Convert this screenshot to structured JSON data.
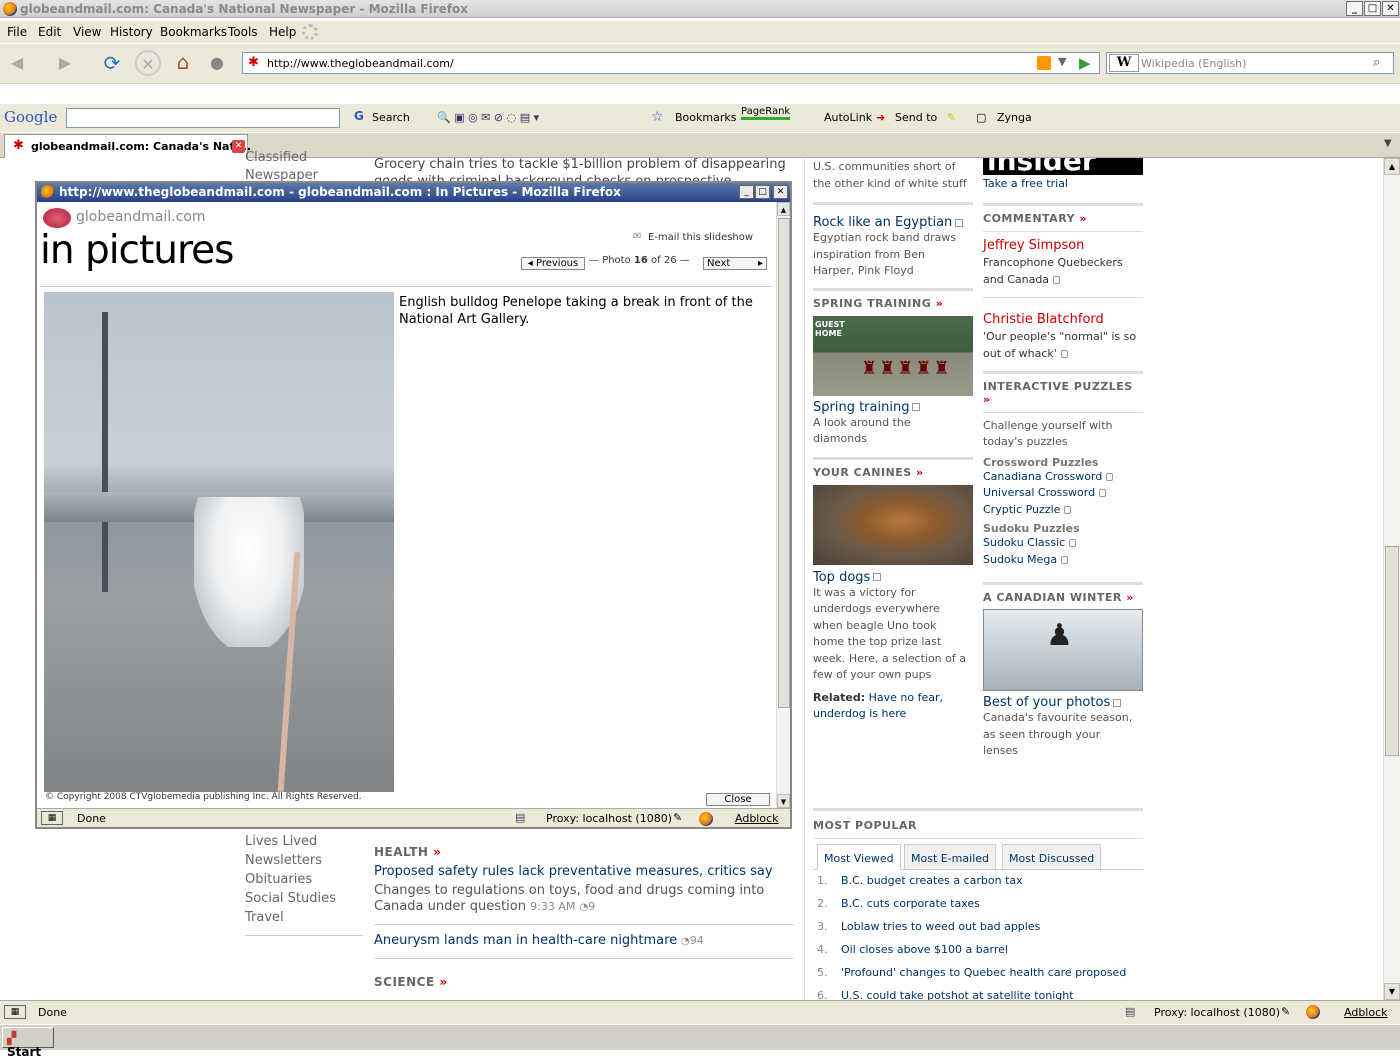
{
  "window": {
    "title": "globeandmail.com: Canada's National Newspaper - Mozilla Firefox",
    "minimize": "_",
    "maximize": "□",
    "close": "✕"
  },
  "menu": [
    "File",
    "Edit",
    "View",
    "History",
    "Bookmarks",
    "Tools",
    "Help"
  ],
  "address": {
    "url": "http://www.theglobeandmail.com/",
    "search_placeholder": "Wikipedia (English)"
  },
  "google_toolbar": {
    "logo": "Google",
    "search": "Search",
    "bookmarks": "Bookmarks",
    "pagerank": "PageRank",
    "autolink": "AutoLink",
    "sendto": "Send to",
    "zynga": "Zynga"
  },
  "tab": {
    "label": "globeandmail.com: Canada's Nati..."
  },
  "page": {
    "left_nav_top": [
      "Classified",
      "Newspaper Ads"
    ],
    "left_nav_bottom": [
      "Lives Lived",
      "Newsletters",
      "Obituaries",
      "Social Studies",
      "Travel"
    ],
    "center_top_text": [
      "Grocery chain tries to tackle $1-billion problem of disappearing",
      "goods with criminal background checks on prospective employees"
    ],
    "health": {
      "heading": "HEALTH",
      "story1_title": "Proposed safety rules lack preventative measures, critics say",
      "story1_text1": "Changes to regulations on toys, food and drugs coming into",
      "story1_text2": "Canada under question",
      "story1_time": "9:33 AM",
      "story1_comments": "9",
      "story2_title": "Aneurysm lands man in health-care nightmare",
      "story2_comments": "94"
    },
    "science": {
      "heading": "SCIENCE"
    },
    "col3": {
      "top_text1": "U.S. communities short of",
      "top_text2": "the other kind of white stuff",
      "egypt_title": "Rock like an Egyptian",
      "egypt_text": [
        "Egyptian rock band draws",
        "inspiration from Ben",
        "Harper, Pink Floyd"
      ],
      "spring_heading": "SPRING TRAINING",
      "spring_title": "Spring training",
      "spring_text": [
        "A look around the",
        "diamonds"
      ],
      "spring_scoreboard": "GUEST HOME",
      "canines_heading": "YOUR CANINES",
      "topdogs_title": "Top dogs",
      "topdogs_text": [
        "It was a victory for",
        "underdogs everywhere",
        "when beagle Uno took",
        "home the top prize last",
        "week. Here, a selection of a",
        "few of your own pups"
      ],
      "related_label": "Related:",
      "related_link1": "Have no fear,",
      "related_link2": "underdog is here"
    },
    "col4": {
      "insider_text": "insider",
      "trial": "Take a free trial",
      "commentary_heading": "COMMENTARY",
      "simpson_name": "Jeffrey Simpson",
      "simpson_text1": "Francophone Quebeckers",
      "simpson_text2": "and Canada",
      "blatch_name": "Christie Blatchford",
      "blatch_text1": "'Our people's \"normal\" is so",
      "blatch_text2": "out of whack'",
      "puzzles_heading": "INTERACTIVE PUZZLES",
      "puzzles_text1": "Challenge yourself with",
      "puzzles_text2": "today's puzzles",
      "crossword_heading": "Crossword Puzzles",
      "crossword_links": [
        "Canadiana Crossword",
        "Universal Crossword",
        "Cryptic Puzzle"
      ],
      "sudoku_heading": "Sudoku Puzzles",
      "sudoku_links": [
        "Sudoku Classic",
        "Sudoku Mega"
      ],
      "winter_heading": "A CANADIAN WINTER",
      "winter_title": "Best of your photos",
      "winter_text": [
        "Canada's favourite season,",
        "as seen through your",
        "lenses"
      ]
    },
    "popular": {
      "heading": "MOST POPULAR",
      "tabs": [
        "Most Viewed",
        "Most E-mailed",
        "Most Discussed"
      ],
      "items": [
        {
          "n": "1.",
          "t": "B.C. budget creates a carbon tax"
        },
        {
          "n": "2.",
          "t": "B.C. cuts corporate taxes"
        },
        {
          "n": "3.",
          "t": "Loblaw tries to weed out bad apples"
        },
        {
          "n": "4.",
          "t": "Oil closes above $100 a barrel"
        },
        {
          "n": "5.",
          "t": "'Profound' changes to Quebec health care proposed"
        },
        {
          "n": "6.",
          "t": "U.S. could take potshot at satellite tonight"
        }
      ]
    }
  },
  "popup": {
    "title": "http://www.theglobeandmail.com - globeandmail.com : In Pictures - Mozilla Firefox",
    "brand": "globeandmail.com",
    "heading": "in pictures",
    "email": "E-mail this slideshow",
    "prev": "Previous",
    "photo_label": "Photo",
    "photo_num": "16",
    "photo_of": "of 26",
    "next": "Next",
    "caption": "English bulldog Penelope taking a break in front of the National Art Gallery.",
    "copyright": "© Copyright 2008 CTVglobemedia publishing Inc. All Rights Reserved.",
    "close": "Close",
    "status": "Done",
    "proxy": "Proxy: localhost (1080)",
    "adblock": "Adblock"
  },
  "status": {
    "text": "Done",
    "proxy": "Proxy: localhost (1080)",
    "adblock": "Adblock"
  },
  "taskbar": {
    "start": "Start"
  }
}
